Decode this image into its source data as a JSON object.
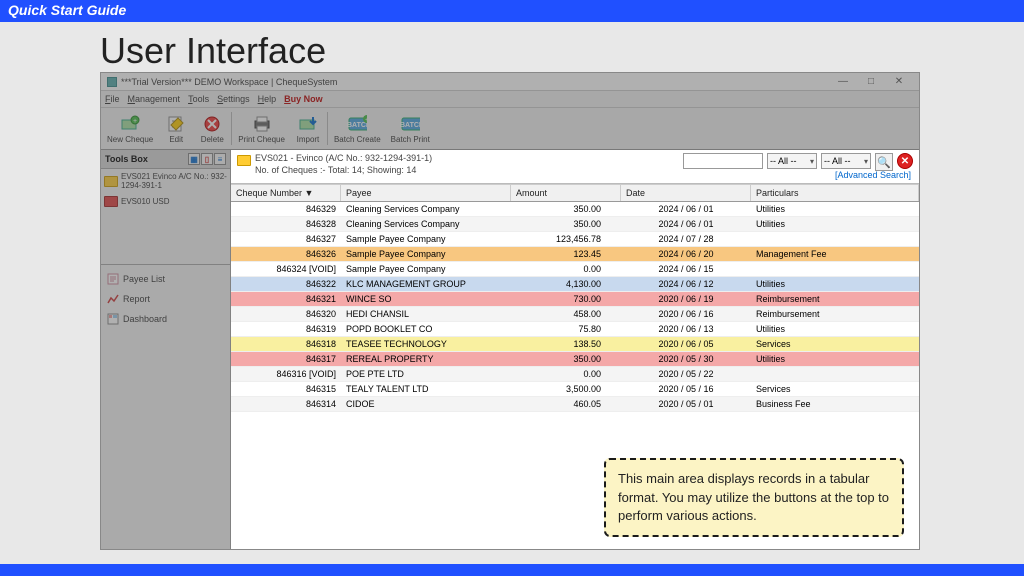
{
  "guide_title": "Quick Start Guide",
  "page_heading": "User Interface",
  "window": {
    "title": "***Trial Version*** DEMO Workspace | ChequeSystem",
    "min": "—",
    "max": "□",
    "close": "✕"
  },
  "menu": {
    "file": "File",
    "mgmt": "Management",
    "tools": "Tools",
    "settings": "Settings",
    "help": "Help",
    "buy": "Buy Now"
  },
  "toolbar": {
    "new_cheque": "New Cheque",
    "edit": "Edit",
    "delete": "Delete",
    "print": "Print Cheque",
    "import": "Import",
    "batch_create": "Batch Create",
    "batch_print": "Batch Print"
  },
  "tools_box": {
    "header": "Tools Box"
  },
  "accounts": [
    {
      "label": "EVS021 Evinco A/C No.: 932-1294-391-1",
      "color": "yellow"
    },
    {
      "label": "EVS010 USD",
      "color": "red"
    }
  ],
  "nav": {
    "payee": "Payee List",
    "report": "Report",
    "dashboard": "Dashboard"
  },
  "summary": {
    "line1": "EVS021 - Evinco (A/C No.: 932-1294-391-1)",
    "line2": "No. of Cheques :- Total: 14; Showing: 14"
  },
  "filters": {
    "all": "-- All --",
    "advanced": "[Advanced Search]"
  },
  "columns": {
    "num": "Cheque Number ▼",
    "payee": "Payee",
    "amount": "Amount",
    "date": "Date",
    "part": "Particulars"
  },
  "rows": [
    {
      "num": "846329",
      "payee": "Cleaning Services Company",
      "amt": "350.00",
      "date": "2024 / 06 / 01",
      "part": "Utilities",
      "bg": "#ffffff"
    },
    {
      "num": "846328",
      "payee": "Cleaning Services Company",
      "amt": "350.00",
      "date": "2024 / 06 / 01",
      "part": "Utilities",
      "bg": "#f4f4f4"
    },
    {
      "num": "846327",
      "payee": "Sample Payee Company",
      "amt": "123,456.78",
      "date": "2024 / 07 / 28",
      "part": "",
      "bg": "#ffffff"
    },
    {
      "num": "846326",
      "payee": "Sample Payee Company",
      "amt": "123.45",
      "date": "2024 / 06 / 20",
      "part": "Management Fee",
      "bg": "#f8c780"
    },
    {
      "num": "846324 [VOID]",
      "payee": "Sample Payee Company",
      "amt": "0.00",
      "date": "2024 / 06 / 15",
      "part": "",
      "bg": "#ffffff"
    },
    {
      "num": "846322",
      "payee": "KLC MANAGEMENT GROUP",
      "amt": "4,130.00",
      "date": "2024 / 06 / 12",
      "part": "Utilities",
      "bg": "#c8d9ee"
    },
    {
      "num": "846321",
      "payee": "WINCE SO",
      "amt": "730.00",
      "date": "2020 / 06 / 19",
      "part": "Reimbursement",
      "bg": "#f4a8a8"
    },
    {
      "num": "846320",
      "payee": "HEDI CHANSIL",
      "amt": "458.00",
      "date": "2020 / 06 / 16",
      "part": "Reimbursement",
      "bg": "#f4f4f4"
    },
    {
      "num": "846319",
      "payee": "POPD BOOKLET CO",
      "amt": "75.80",
      "date": "2020 / 06 / 13",
      "part": "Utilities",
      "bg": "#ffffff"
    },
    {
      "num": "846318",
      "payee": "TEASEE TECHNOLOGY",
      "amt": "138.50",
      "date": "2020 / 06 / 05",
      "part": "Services",
      "bg": "#f9f0a0"
    },
    {
      "num": "846317",
      "payee": "REREAL PROPERTY",
      "amt": "350.00",
      "date": "2020 / 05 / 30",
      "part": "Utilities",
      "bg": "#f4a8a8"
    },
    {
      "num": "846316 [VOID]",
      "payee": "POE PTE LTD",
      "amt": "0.00",
      "date": "2020 / 05 / 22",
      "part": "",
      "bg": "#f4f4f4"
    },
    {
      "num": "846315",
      "payee": "TEALY TALENT LTD",
      "amt": "3,500.00",
      "date": "2020 / 05 / 16",
      "part": "Services",
      "bg": "#ffffff"
    },
    {
      "num": "846314",
      "payee": "CIDOE",
      "amt": "460.05",
      "date": "2020 / 05 / 01",
      "part": "Business Fee",
      "bg": "#f4f4f4"
    }
  ],
  "callout": "This main area displays records in a tabular format. You may utilize the buttons at the top to perform various actions."
}
